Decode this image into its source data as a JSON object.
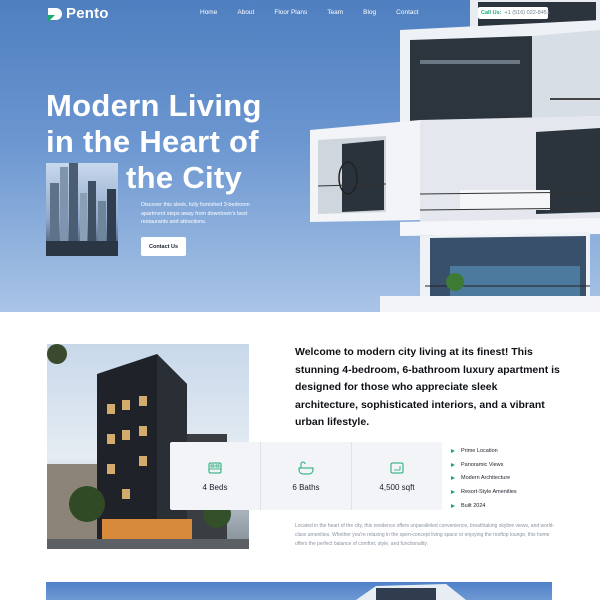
{
  "brand": {
    "name": "Pento",
    "accent": "#19a974"
  },
  "nav": {
    "links": [
      "Home",
      "About",
      "Floor Plans",
      "Team",
      "Blog",
      "Contact"
    ],
    "call_label": "Call Us:",
    "call_number": "+1 (516) 022-8451"
  },
  "hero": {
    "title_lines": [
      "Modern Living",
      "in the Heart of",
      "the City"
    ],
    "description": "Discover this sleek, fully furnished 3-bedroom apartment steps away from downtown's best restaurants and attractions.",
    "cta": "Contact Us"
  },
  "about": {
    "welcome": "Welcome to modern city living at its finest! This stunning 4-bedroom, 6-bathroom luxury apartment is designed for those who appreciate sleek architecture, sophisticated interiors, and a vibrant urban lifestyle.",
    "stats": [
      {
        "icon": "bed-icon",
        "label": "4 Beds"
      },
      {
        "icon": "bathtub-icon",
        "label": "6 Baths"
      },
      {
        "icon": "area-icon",
        "label": "4,500 sqft"
      }
    ],
    "features": [
      "Prime Location",
      "Panoramic Views",
      "Modern Architecture",
      "Resort-Style Amenities",
      "Built 2024"
    ],
    "detail": "Located in the heart of the city, this residence offers unparalleled convenience, breathtaking skyline views, and world-class amenities. Whether you're relaxing in the open-concept living space or enjoying the rooftop lounge, this home offers the perfect balance of comfort, style, and functionality."
  }
}
